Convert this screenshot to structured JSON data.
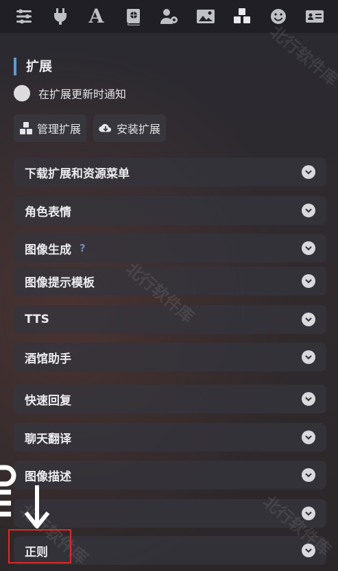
{
  "toolbar": {
    "icons": [
      "sliders-icon",
      "plug-icon",
      "font-icon",
      "book-globe-icon",
      "user-gear-icon",
      "image-icon",
      "cubes-icon",
      "smiley-icon",
      "id-card-icon"
    ],
    "active": "cubes-icon",
    "letter_icon_glyph": "A"
  },
  "section": {
    "title": "扩展",
    "notify_label": "在扩展更新时通知",
    "notify_enabled": false,
    "manage_label": "管理扩展",
    "install_label": "安装扩展"
  },
  "accordion": {
    "items": [
      {
        "label": "下载扩展和资源菜单"
      },
      {
        "label": "角色表情"
      },
      {
        "label": "图像生成",
        "help": "?"
      },
      {
        "label": "图像提示模板"
      },
      {
        "label": "TTS"
      },
      {
        "label": "酒馆助手"
      },
      {
        "label": "快速回复"
      },
      {
        "label": "聊天翻译"
      },
      {
        "label": "图像描述"
      },
      {
        "label": ""
      },
      {
        "label": "正则"
      }
    ]
  },
  "watermark": {
    "text": "北行软件库"
  },
  "colors": {
    "accent": "#5b9bd5",
    "annotation": "#e02a2a"
  }
}
